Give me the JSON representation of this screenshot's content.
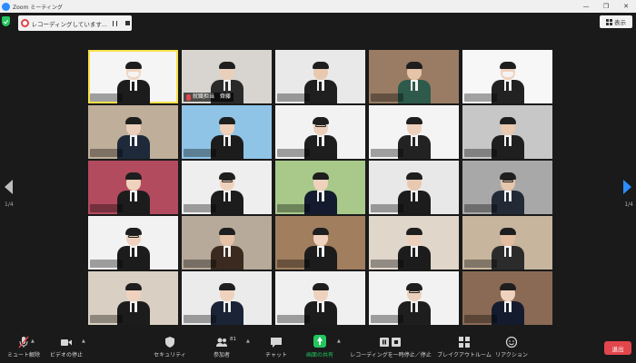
{
  "window": {
    "title": "Zoom ミーティング",
    "minimize": "—",
    "maximize": "❐",
    "close": "✕"
  },
  "recording": {
    "status": "レコーディングしています..."
  },
  "view": {
    "label": "表示"
  },
  "paging": {
    "left": "1/4",
    "right": "1/4"
  },
  "colors": {
    "accent": "#2d8cff",
    "share_green": "#23c55e",
    "leave_red": "#e0464b",
    "active_speaker": "#f7e14a"
  },
  "participants": [
    {
      "bg": "#f5f5f5",
      "skin": "#f0d5c0",
      "suit": "#1c1c1c",
      "accessory": "mask",
      "active": true
    },
    {
      "bg": "#d8d4cf",
      "skin": "#ead0bc",
      "suit": "#2a2a2a",
      "label": "就職担当　齊藤",
      "muted": true
    },
    {
      "bg": "#e9e9e9",
      "skin": "#e8c9b0",
      "suit": "#1f1f1f"
    },
    {
      "bg": "#9a7c64",
      "skin": "#e6c4a8",
      "suit": "#2d5a4a"
    },
    {
      "bg": "#f7f7f7",
      "skin": "#efd2bd",
      "suit": "#222222",
      "accessory": "mask"
    },
    {
      "bg": "#bfae99",
      "skin": "#ead0bc",
      "suit": "#1e2a3a"
    },
    {
      "bg": "#8fc4e6",
      "skin": "#efcfb8",
      "suit": "#1c1c1c"
    },
    {
      "bg": "#f2f2f2",
      "skin": "#ecd0bb",
      "suit": "#1e1e1e",
      "accessory": "glasses"
    },
    {
      "bg": "#f4f4f4",
      "skin": "#ecd0bb",
      "suit": "#222222"
    },
    {
      "bg": "#c7c7c7",
      "skin": "#e8c8ae",
      "suit": "#1f1f1f"
    },
    {
      "bg": "#b24b5e",
      "skin": "#efd2bd",
      "suit": "#1c1c1c"
    },
    {
      "bg": "#eeeeee",
      "skin": "#efd2bd",
      "suit": "#1c1c1c",
      "accessory": "glasses"
    },
    {
      "bg": "#a8c98a",
      "skin": "#efd2bd",
      "suit": "#151b2e"
    },
    {
      "bg": "#e8e8e8",
      "skin": "#e8c9b0",
      "suit": "#1c1c1c"
    },
    {
      "bg": "#a8a8a8",
      "skin": "#e6c6ad",
      "suit": "#222a36",
      "accessory": "glasses"
    },
    {
      "bg": "#f2f2f2",
      "skin": "#efd2bd",
      "suit": "#1c1c1c",
      "accessory": "glasses"
    },
    {
      "bg": "#b7aa9a",
      "skin": "#e5c2a6",
      "suit": "#3a2a20"
    },
    {
      "bg": "#a07e5e",
      "skin": "#efd2bd",
      "suit": "#1c1c1c"
    },
    {
      "bg": "#e0d6ca",
      "skin": "#ecd0bb",
      "suit": "#1c1c1c"
    },
    {
      "bg": "#c7b59e",
      "skin": "#e3bca0",
      "suit": "#2b2b2b"
    },
    {
      "bg": "#d9cfc2",
      "skin": "#efd2bd",
      "suit": "#1c1c1c"
    },
    {
      "bg": "#ebebeb",
      "skin": "#efd2bd",
      "suit": "#1b2436"
    },
    {
      "bg": "#f0f0f0",
      "skin": "#efd2bd",
      "suit": "#1c1c1c"
    },
    {
      "bg": "#f2f2f2",
      "skin": "#ecd0bb",
      "suit": "#1e1e1e",
      "accessory": "glasses"
    },
    {
      "bg": "#8a6a55",
      "skin": "#efd2bd",
      "suit": "#151b2e"
    }
  ],
  "toolbar": {
    "unmute": "ミュート解除",
    "stop_video": "ビデオの停止",
    "security": "セキュリティ",
    "participants": "参加者",
    "participants_count": "81",
    "chat": "チャット",
    "share_screen": "画面の共有",
    "pause_recording": "レコーディングを一時停止／停止",
    "breakout_rooms": "ブレイクアウトルーム",
    "reactions": "リアクション",
    "leave": "退出"
  }
}
